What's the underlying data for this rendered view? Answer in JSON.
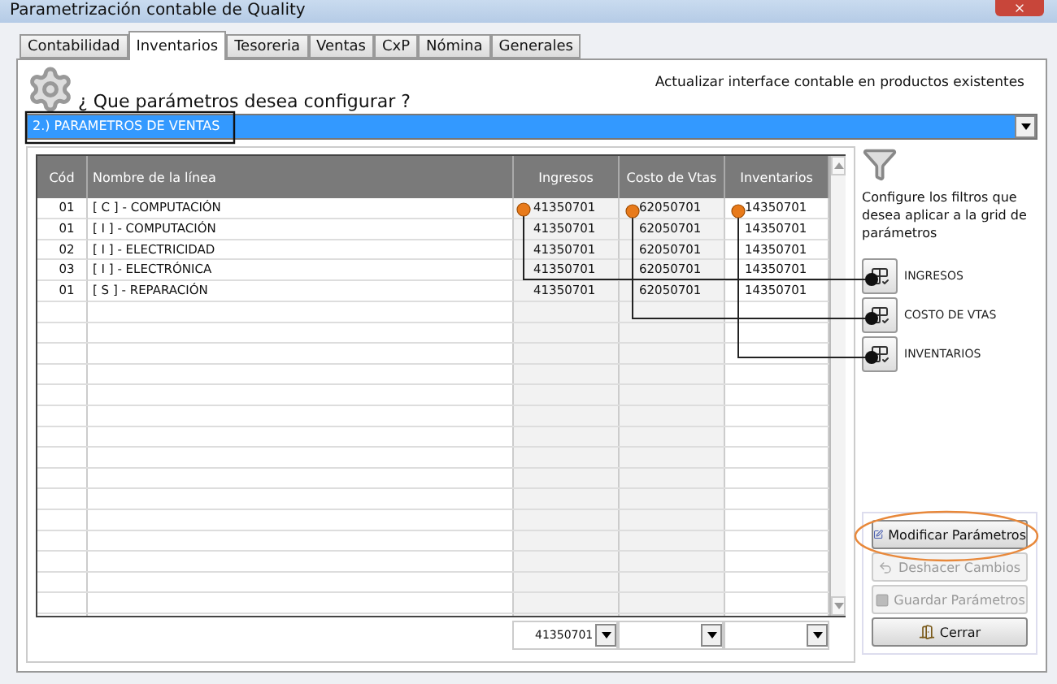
{
  "window": {
    "title": "Parametrización contable de Quality"
  },
  "tabs": [
    {
      "label": "Contabilidad",
      "selected": false
    },
    {
      "label": "Inventarios",
      "selected": true
    },
    {
      "label": "Tesoreria",
      "selected": false
    },
    {
      "label": "Ventas",
      "selected": false
    },
    {
      "label": "CxP",
      "selected": false
    },
    {
      "label": "Nómina",
      "selected": false
    },
    {
      "label": "Generales",
      "selected": false
    }
  ],
  "prompt": "¿ Que parámetros desea configurar ?",
  "update_link": "Actualizar interface contable en productos existentes",
  "parameter_select": {
    "value": "2.) PARAMETROS DE VENTAS",
    "selected": true
  },
  "grid": {
    "columns": [
      "Cód",
      "Nombre de la línea",
      "Ingresos",
      "Costo de Vtas",
      "Inventarios"
    ],
    "rows": [
      [
        "01",
        "[ C ] - COMPUTACIÓN",
        "41350701",
        "62050701",
        "14350701"
      ],
      [
        "01",
        "[ I ] - COMPUTACIÓN",
        "41350701",
        "62050701",
        "14350701"
      ],
      [
        "02",
        "[ I ] - ELECTRICIDAD",
        "41350701",
        "62050701",
        "14350701"
      ],
      [
        "03",
        "[ I ] - ELECTRÓNICA",
        "41350701",
        "62050701",
        "14350701"
      ],
      [
        "01",
        "[ S ] - REPARACIÓN",
        "41350701",
        "62050701",
        "14350701"
      ]
    ],
    "column_filters": [
      {
        "value": "41350701"
      }
    ]
  },
  "filter_hint": "Configure los filtros que desea aplicar a la grid de parámetros",
  "filter_buttons": [
    "INGRESOS",
    "COSTO DE VTAS",
    "INVENTARIOS"
  ],
  "actions": [
    {
      "label": "Modificar Parámetros",
      "kind": "edit",
      "disabled": false,
      "highlighted": true
    },
    {
      "label": "Deshacer Cambios",
      "kind": "undo",
      "disabled": true,
      "highlighted": false
    },
    {
      "label": "Guardar Parámetros",
      "kind": "save",
      "disabled": true,
      "highlighted": false
    },
    {
      "label": "Cerrar",
      "kind": "close",
      "disabled": false,
      "highlighted": false
    }
  ]
}
